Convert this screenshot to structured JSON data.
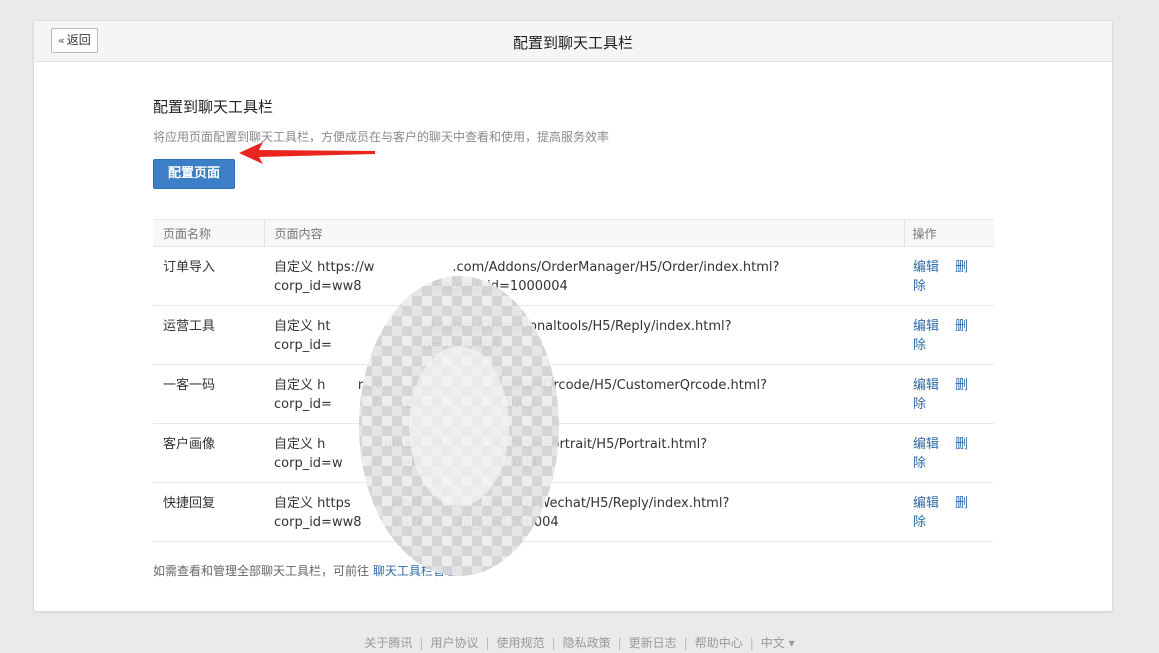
{
  "header": {
    "back_label": "返回",
    "title": "配置到聊天工具栏"
  },
  "section": {
    "title": "配置到聊天工具栏",
    "description": "将应用页面配置到聊天工具栏，方便成员在与客户的聊天中查看和使用，提高服务效率",
    "config_button": "配置页面"
  },
  "table": {
    "columns": [
      "页面名称",
      "页面内容",
      "操作"
    ],
    "rows": [
      {
        "name": "订单导入",
        "line1": "自定义 https://w            .com/Addons/OrderManager/H5/Order/index.html?",
        "line2": "corp_id=ww8           &agent_id=1000004",
        "edit": "编辑",
        "delete": "删除"
      },
      {
        "name": "运营工具",
        "line1": "自定义 ht               Addons/Operationaltools/H5/Reply/index.html?",
        "line2": "corp_id=              d=1000004",
        "edit": "编辑",
        "delete": "删除"
      },
      {
        "name": "一客一码",
        "line1": "自定义 h     rk.v     com/A   /CustomerQrcode/H5/CustomerQrcode.html?",
        "line2": "corp_id=      7    ab&ag   =1000004",
        "edit": "编辑",
        "delete": "删除"
      },
      {
        "name": "客户画像",
        "line1": "自定义 h         hina.com/A   /CustomerPortrait/H5/Portrait.html?",
        "line2": "corp_id=w    a    efab&a   =1000004",
        "edit": "编辑",
        "delete": "删除"
      },
      {
        "name": "快捷回复",
        "line1": "自定义 https      ymchina.co   dons/QyWechat/H5/Reply/index.html?",
        "line2": "corp_id=ww8     c47e     nt_id=1000004",
        "edit": "编辑",
        "delete": "删除"
      }
    ]
  },
  "footer_note": {
    "text": "如需查看和管理全部聊天工具栏，可前往",
    "link": "聊天工具栏管理"
  },
  "bottom_links": [
    "关于腾讯",
    "用户协议",
    "使用规范",
    "隐私政策",
    "更新日志",
    "帮助中心",
    "中文 ▾"
  ],
  "colors": {
    "accent": "#3d7fc7",
    "link": "#2e6ca8",
    "arrow": "#e8251f"
  }
}
